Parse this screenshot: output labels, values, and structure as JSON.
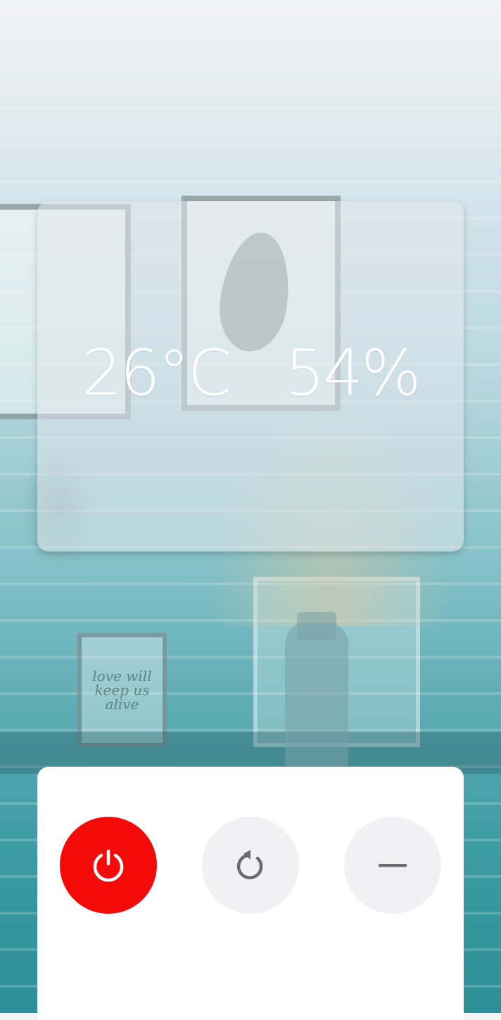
{
  "sensor": {
    "temperature": "26°C",
    "humidity": "54%"
  },
  "background": {
    "poster_text": "love will keep us alive"
  },
  "controls": {
    "power": {
      "icon": "power-icon",
      "color": "#f50a0a"
    },
    "cycle": {
      "icon": "refresh-icon",
      "color": "#f1f1f3"
    },
    "minus": {
      "icon": "minus-icon",
      "color": "#f1f1f3"
    }
  }
}
